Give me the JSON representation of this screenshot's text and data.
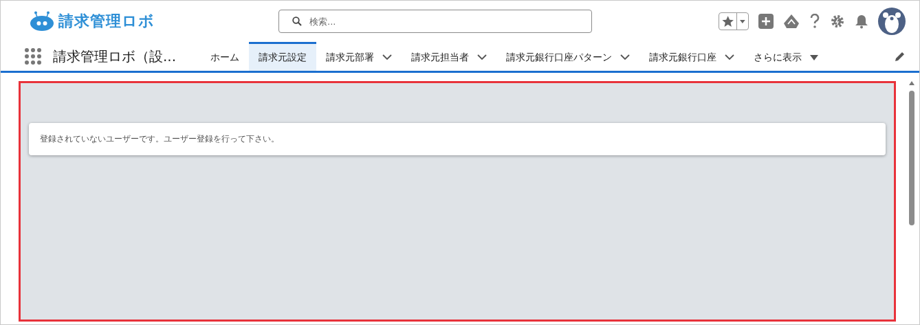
{
  "header": {
    "logo_text": "請求管理ロボ",
    "search": {
      "placeholder": "検索..."
    }
  },
  "nav": {
    "app_name": "請求管理ロボ（設...",
    "tabs": [
      {
        "label": "ホーム",
        "selected": false,
        "kind": "plain"
      },
      {
        "label": "請求元設定",
        "selected": true,
        "kind": "plain"
      },
      {
        "label": "請求元部署",
        "selected": false,
        "kind": "dropdown"
      },
      {
        "label": "請求元担当者",
        "selected": false,
        "kind": "dropdown"
      },
      {
        "label": "請求元銀行口座パターン",
        "selected": false,
        "kind": "dropdown"
      },
      {
        "label": "請求元銀行口座",
        "selected": false,
        "kind": "dropdown"
      },
      {
        "label": "さらに表示",
        "selected": false,
        "kind": "more"
      }
    ]
  },
  "content": {
    "message": "登録されていないユーザーです。ユーザー登録を行って下さい。"
  }
}
